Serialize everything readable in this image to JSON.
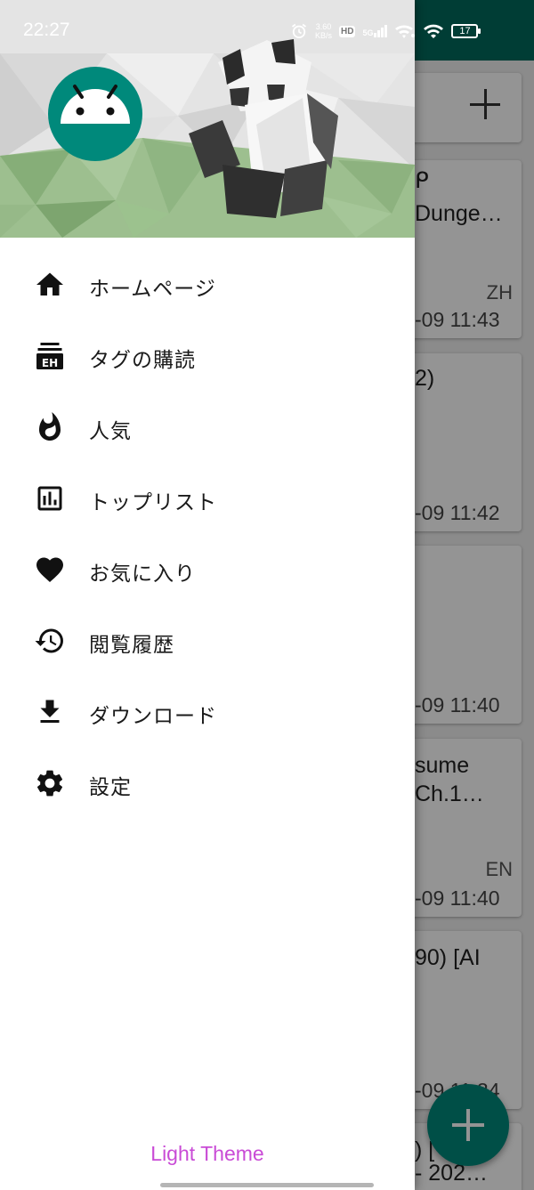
{
  "status_bar": {
    "time": "22:27",
    "net_speed_value": "3.60",
    "net_speed_unit": "KB/s",
    "hd_badge": "HD",
    "network": "5G",
    "battery": "17"
  },
  "drawer": {
    "menu_items": [
      {
        "label": "ホームページ",
        "icon": "home-icon"
      },
      {
        "label": "タグの購読",
        "icon": "eh-tag-icon"
      },
      {
        "label": "人気",
        "icon": "fire-icon"
      },
      {
        "label": "トップリスト",
        "icon": "bar-chart-icon"
      },
      {
        "label": "お気に入り",
        "icon": "heart-icon"
      },
      {
        "label": "閲覧履歴",
        "icon": "history-icon"
      },
      {
        "label": "ダウンロード",
        "icon": "download-icon"
      },
      {
        "label": "設定",
        "icon": "gear-icon"
      }
    ],
    "theme_toggle_label": "Light Theme"
  },
  "background_list": {
    "cards": [
      {
        "title_line1": "ᑭ",
        "title_line2": "Dunge…",
        "lang": "ZH",
        "date": "-09 11:43"
      },
      {
        "title_line1": "2)",
        "title_line2": "",
        "lang": "",
        "date": "-09 11:42"
      },
      {
        "title_line1": "",
        "title_line2": "",
        "lang": "",
        "date": "-09 11:40"
      },
      {
        "title_line1": "sume",
        "title_line2": "Ch.1…",
        "lang": "EN",
        "date": "-09 11:40"
      },
      {
        "title_line1": "90) [AI",
        "title_line2": "",
        "lang": "",
        "date": "-09 11:34"
      },
      {
        "title_line1": ") [",
        "title_line2": "- 202…",
        "lang": "",
        "date": ""
      }
    ]
  },
  "colors": {
    "primary": "#00695c",
    "accent": "#00897b",
    "theme_link": "#c94bd6"
  }
}
